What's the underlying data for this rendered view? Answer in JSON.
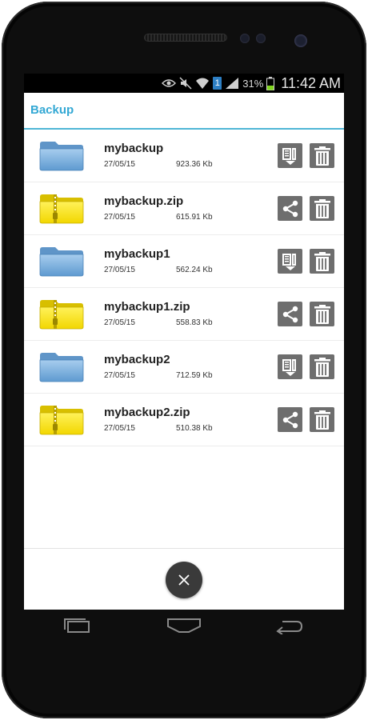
{
  "status_bar": {
    "sim_number": "1",
    "battery_percent": "31%",
    "time": "11:42 AM"
  },
  "app": {
    "title": "Backup"
  },
  "files": [
    {
      "name": "mybackup",
      "date": "27/05/15",
      "size": "923.36 Kb",
      "kind": "folder"
    },
    {
      "name": "mybackup.zip",
      "date": "27/05/15",
      "size": "615.91 Kb",
      "kind": "zip"
    },
    {
      "name": "mybackup1",
      "date": "27/05/15",
      "size": "562.24 Kb",
      "kind": "folder"
    },
    {
      "name": "mybackup1.zip",
      "date": "27/05/15",
      "size": "558.83 Kb",
      "kind": "zip"
    },
    {
      "name": "mybackup2",
      "date": "27/05/15",
      "size": "712.59 Kb",
      "kind": "folder"
    },
    {
      "name": "mybackup2.zip",
      "date": "27/05/15",
      "size": "510.38 Kb",
      "kind": "zip"
    }
  ],
  "icons": {
    "folder": "folder-icon",
    "zip": "zip-folder-icon",
    "compress": "compress-icon",
    "share": "share-icon",
    "delete": "trash-icon",
    "close": "close-icon"
  },
  "colors": {
    "accent": "#33a8d4",
    "action_bg": "#6e6e6e",
    "folder_blue": "#7fb3de",
    "zip_yellow": "#f7e400"
  }
}
